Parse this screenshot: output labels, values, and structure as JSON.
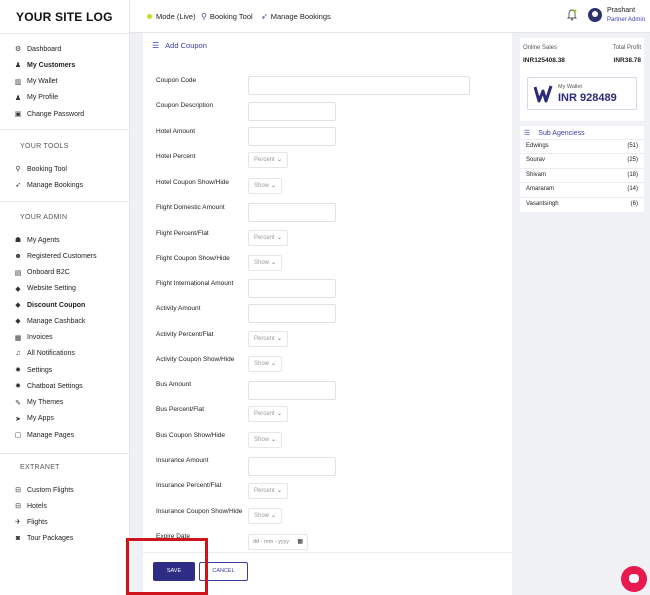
{
  "app": {
    "logo": "YOUR SITE LOG"
  },
  "sidebar": {
    "main": [
      {
        "label": "Dashboard",
        "icon": "dashboard-icon",
        "glyph": "⚙"
      },
      {
        "label": "My Customers",
        "icon": "user-icon",
        "glyph": "♟"
      },
      {
        "label": "My Wallet",
        "icon": "wallet-icon",
        "glyph": "▥"
      },
      {
        "label": "My Profile",
        "icon": "profile-icon",
        "glyph": "♟"
      },
      {
        "label": "Change Password",
        "icon": "lock-icon",
        "glyph": "▣"
      }
    ],
    "tools_heading": "YOUR TOOLS",
    "tools": [
      {
        "label": "Booking Tool",
        "icon": "search-icon",
        "glyph": "⚲"
      },
      {
        "label": "Manage Bookings",
        "icon": "rocket-icon",
        "glyph": "➶"
      }
    ],
    "admin_heading": "YOUR ADMIN",
    "admin": [
      {
        "label": "My Agents",
        "icon": "users-icon",
        "glyph": "☗"
      },
      {
        "label": "Registered Customers",
        "icon": "user-plus-icon",
        "glyph": "☻"
      },
      {
        "label": "Onboard B2C",
        "icon": "clipboard-icon",
        "glyph": "▤"
      },
      {
        "label": "Website Setting",
        "icon": "tag-icon",
        "glyph": "◆"
      },
      {
        "label": "Discount Coupon",
        "icon": "tags-icon",
        "glyph": "◆"
      },
      {
        "label": "Manage Cashback",
        "icon": "tag-icon",
        "glyph": "◆"
      },
      {
        "label": "Invoices",
        "icon": "invoice-icon",
        "glyph": "▦"
      },
      {
        "label": "All Notifications",
        "icon": "bell-icon",
        "glyph": "♫"
      },
      {
        "label": "Settings",
        "icon": "gear-icon",
        "glyph": "✹"
      },
      {
        "label": "Chatboat Settings",
        "icon": "gear-icon",
        "glyph": "✹"
      },
      {
        "label": "My Themes",
        "icon": "paint-icon",
        "glyph": "✎"
      },
      {
        "label": "My Apps",
        "icon": "send-icon",
        "glyph": "➤"
      },
      {
        "label": "Manage Pages",
        "icon": "pages-icon",
        "glyph": "▢"
      }
    ],
    "extranet_heading": "EXTRANET",
    "extranet": [
      {
        "label": "Custom Flights",
        "icon": "bed-icon",
        "glyph": "⊟"
      },
      {
        "label": "Hotels",
        "icon": "bed-icon",
        "glyph": "⊟"
      },
      {
        "label": "Flights",
        "icon": "plane-icon",
        "glyph": "✈"
      },
      {
        "label": "Tour Packages",
        "icon": "camera-icon",
        "glyph": "◙"
      }
    ]
  },
  "header": {
    "mode": "Mode (Live)",
    "booking_tool": "Booking Tool",
    "manage_bookings": "Manage Bookings",
    "user_name": "Prashant",
    "user_role": "Partner Admin"
  },
  "form": {
    "title": "Add Coupon",
    "fields": [
      {
        "label": "Coupon Code",
        "type": "text-wide"
      },
      {
        "label": "Coupon Description",
        "type": "text"
      },
      {
        "label": "Hotel Amount",
        "type": "text"
      },
      {
        "label": "Hotel Percent",
        "type": "select",
        "value": "Percent"
      },
      {
        "label": "Hotel Coupon Show/Hide",
        "type": "select-sm",
        "value": "Show"
      },
      {
        "label": "Flight Domestic Amount",
        "type": "text"
      },
      {
        "label": "Flight Percent/Flat",
        "type": "select",
        "value": "Percent"
      },
      {
        "label": "Flight Coupon Show/Hide",
        "type": "select-sm",
        "value": "Show"
      },
      {
        "label": "Flight International Amount",
        "type": "text"
      },
      {
        "label": "Activity Amount",
        "type": "text"
      },
      {
        "label": "Activity Percent/Flat",
        "type": "select",
        "value": "Percent"
      },
      {
        "label": "Activity Coupon Show/Hide",
        "type": "select-sm",
        "value": "Show"
      },
      {
        "label": "Bus Amount",
        "type": "text"
      },
      {
        "label": "Bus Percent/Flat",
        "type": "select",
        "value": "Percent"
      },
      {
        "label": "Bus Coupon Show/Hide",
        "type": "select-sm",
        "value": "Show"
      },
      {
        "label": "Insurance Amount",
        "type": "text"
      },
      {
        "label": "Insurance Percent/Flat",
        "type": "select",
        "value": "Percent"
      },
      {
        "label": "Insurance Coupon Show/Hide",
        "type": "select-sm",
        "value": "Show"
      },
      {
        "label": "Expire Date",
        "type": "date",
        "value": "dd - mm - yyyy"
      }
    ],
    "save_label": "SAVE",
    "cancel_label": "CANCEL"
  },
  "stats": {
    "online_sales_label": "Online Sales",
    "online_sales_value": "INR125408.38",
    "total_profit_label": "Total Profit",
    "total_profit_value": "INR38.78",
    "wallet_label": "My Wallet",
    "wallet_amount": "INR 928489"
  },
  "agencies": {
    "title": "Sub Agenciess",
    "rows": [
      {
        "name": "Edwings",
        "count": "(51)"
      },
      {
        "name": "Sourav",
        "count": "(25)"
      },
      {
        "name": "Shivam",
        "count": "(18)"
      },
      {
        "name": "Amararam",
        "count": "(14)"
      },
      {
        "name": "Vasantsingh",
        "count": "(6)"
      }
    ]
  },
  "colors": {
    "brand": "#3a3fa8",
    "save": "#2f2c86",
    "highlight": "#d0141e",
    "chat": "#e8194e",
    "live": "#c8e023"
  }
}
